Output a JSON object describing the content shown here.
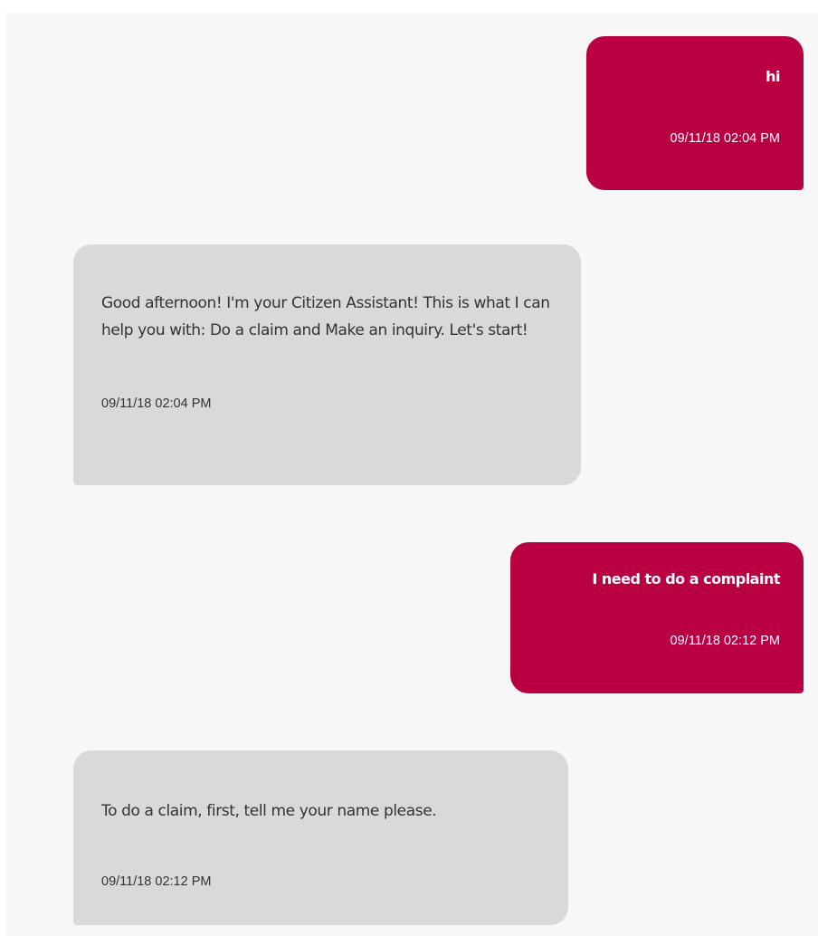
{
  "messages": [
    {
      "sender": "user",
      "text": "hi",
      "time": "09/11/18 02:04 PM"
    },
    {
      "sender": "bot",
      "text": "Good afternoon! I'm your Citizen Assistant! This is what I can help you with: Do a claim and Make an inquiry. Let's start!",
      "time": "09/11/18 02:04 PM"
    },
    {
      "sender": "user",
      "text": "I need to do a complaint",
      "time": "09/11/18 02:12 PM"
    },
    {
      "sender": "bot",
      "text": "To do a claim, first, tell me your name please.",
      "time": "09/11/18 02:12 PM"
    }
  ],
  "colors": {
    "user_bubble": "#b80043",
    "bot_bubble": "#d9d9d9",
    "panel_background": "#f7f7f7"
  }
}
